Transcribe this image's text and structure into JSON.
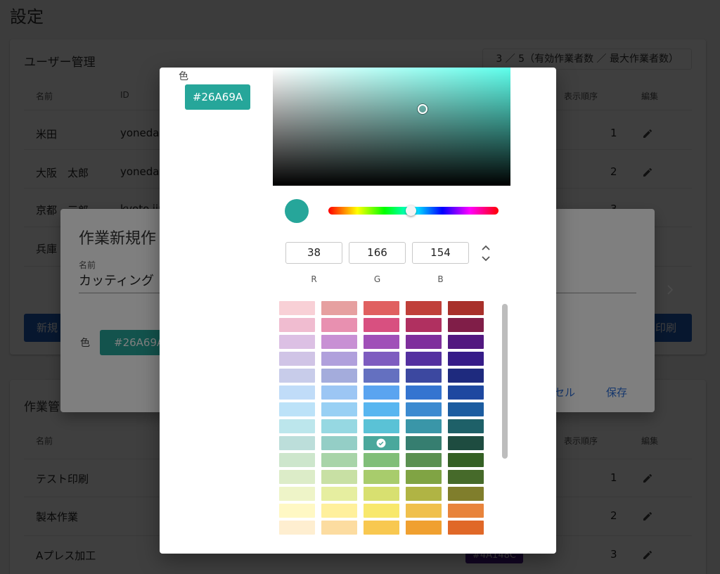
{
  "page": {
    "title": "設定"
  },
  "users": {
    "title": "ユーザー管理",
    "count": "3 ／ 5（有効作業者数 ／ 最大作業者数）",
    "headers": {
      "name": "名前",
      "id": "ID",
      "order": "表示順序",
      "edit": "編集"
    },
    "rows": [
      {
        "name": "米田",
        "id": "yoneda@",
        "order": "1"
      },
      {
        "name": "大阪　太郎",
        "id": "yonedat",
        "order": "2"
      },
      {
        "name": "京都　三郎",
        "id": "kyoto.jir",
        "order": "3"
      },
      {
        "name": "兵庫"
      }
    ],
    "new_button": "新規",
    "print_button": "印刷"
  },
  "tasks": {
    "title": "作業管",
    "headers": {
      "name": "名前",
      "order": "表示順序",
      "edit": "編集"
    },
    "rows": [
      {
        "name": "テスト印刷",
        "order": "1"
      },
      {
        "name": "製本作業",
        "order": "2"
      },
      {
        "name": "Aプレス加工",
        "order": "3",
        "chip": "#4A148C"
      }
    ]
  },
  "create_dialog": {
    "title": "作業新規作",
    "name_label": "名前",
    "name_value": "カッティング",
    "color_label": "色",
    "color_value": "#26A69A",
    "cancel": "セル",
    "save": "保存"
  },
  "colors": {
    "selected": "#26A69A",
    "sv_hue": "#5EFFEC",
    "purple_chip": "#4A148C",
    "primary_button": "#1F5FBF"
  },
  "picker": {
    "label": "色",
    "hex": "#26A69A",
    "rgb": {
      "r": "38",
      "g": "166",
      "b": "154"
    },
    "rgb_labels": {
      "r": "R",
      "g": "G",
      "b": "B"
    },
    "swatch_rows": [
      [
        "#F8D0D6",
        "#E6A0A0",
        "#E06060",
        "#C0403A",
        "#A8302A"
      ],
      [
        "#F0BCD0",
        "#E890B0",
        "#D85080",
        "#B03060",
        "#801E48"
      ],
      [
        "#DCC0E4",
        "#C890D4",
        "#A050B8",
        "#7E2E9C",
        "#521880"
      ],
      [
        "#D0C4E6",
        "#B0A0DC",
        "#7E5CC0",
        "#5430A0",
        "#361C88"
      ],
      [
        "#C8CCEA",
        "#A4ACDC",
        "#6470C0",
        "#3C48A0",
        "#1E2A7E"
      ],
      [
        "#C0DCF8",
        "#9CC6F4",
        "#5AA4F0",
        "#3474D0",
        "#1E48A0"
      ],
      [
        "#BCE2F8",
        "#98D0F4",
        "#58B6F0",
        "#3C8AD0",
        "#1C5CA0"
      ],
      [
        "#BCE6EC",
        "#96D8E2",
        "#5AC2D6",
        "#3A96A8",
        "#1E6068"
      ],
      [
        "#BCDEDA",
        "#94CEC6",
        "#4AA89C",
        "#367E70",
        "#1E4C40"
      ],
      [
        "#CDE6CC",
        "#A8D4A8",
        "#80BE78",
        "#5A9050",
        "#346024"
      ],
      [
        "#DCECC8",
        "#C8E0A4",
        "#A8CC6C",
        "#80A444",
        "#466A2A"
      ],
      [
        "#EEF4C8",
        "#E6EEA0",
        "#D8E070",
        "#B0B444",
        "#807E2C"
      ],
      [
        "#FFF8C4",
        "#FFF09C",
        "#F8E86C",
        "#F0C04C",
        "#E8843C"
      ],
      [
        "#FEEED0",
        "#FCDCA0",
        "#F8C850",
        "#F0A030",
        "#E06828"
      ]
    ],
    "selected_row": 8,
    "selected_col": 2,
    "sv_cursor_saturation": 0.63,
    "sv_cursor_value": 0.65,
    "hue_degrees": 174
  }
}
